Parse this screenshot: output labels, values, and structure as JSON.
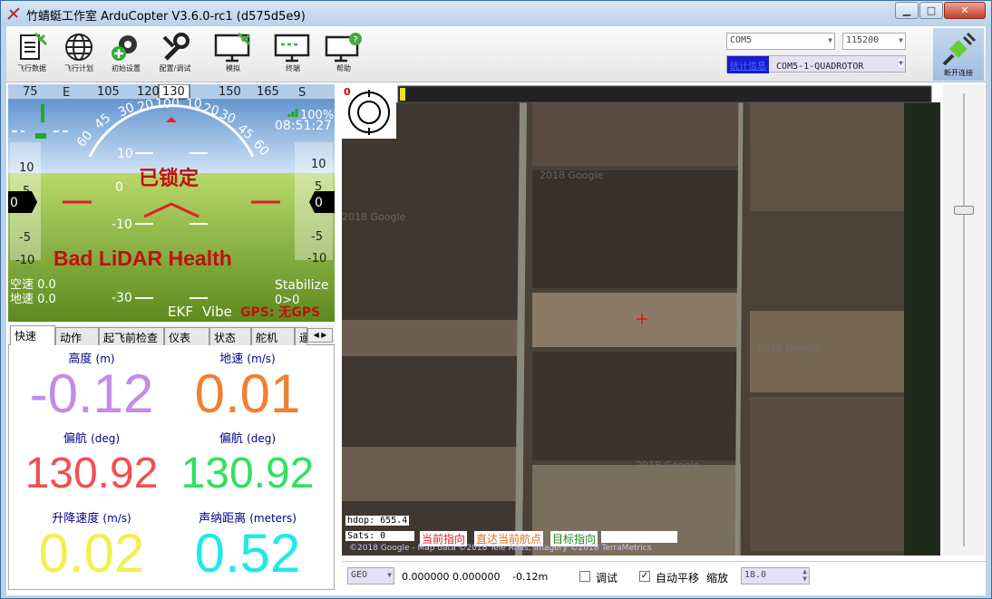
{
  "window": {
    "title": "竹蜻蜓工作室 ArduCopter V3.6.0-rc1 (d575d5e9)",
    "min_label": "▁",
    "max_label": "□",
    "close_label": "✕"
  },
  "toolbar": {
    "items": [
      {
        "label": "飞行数据",
        "icon": "flight-data-icon"
      },
      {
        "label": "飞行计划",
        "icon": "globe-icon"
      },
      {
        "label": "初始设置",
        "icon": "gear-plus-icon"
      },
      {
        "label": "配置/调试",
        "icon": "wrench-icon"
      },
      {
        "label": "模拟",
        "icon": "monitor-plane-icon"
      },
      {
        "label": "终端",
        "icon": "terminal-icon"
      },
      {
        "label": "帮助",
        "icon": "help-icon"
      }
    ],
    "port": "COM5",
    "baud": "115200",
    "link_stats": "统计信息",
    "link_name": "COM5-1-QUADROTOR",
    "connect_label": "断开连接"
  },
  "hud": {
    "heading_ticks": [
      "75",
      "E",
      "105",
      "120",
      "130",
      "150",
      "165",
      "S"
    ],
    "heading_value": "130",
    "roll_ticks": [
      "60",
      "45",
      "30",
      "20",
      "10",
      "0",
      "10",
      "20",
      "30",
      "45",
      "60"
    ],
    "pitch_ticks": [
      "10",
      "0",
      "-10",
      "-30"
    ],
    "speed_ticks": [
      "10",
      "5",
      "0",
      "-5",
      "-10"
    ],
    "alt_ticks": [
      "10",
      "5",
      "0",
      "-5",
      "-10"
    ],
    "speed_box": "0",
    "alt_box": "0",
    "battery": "100%",
    "time": "08:51:27",
    "armed_text": "已锁定",
    "warning": "Bad LiDAR Health",
    "airspeed": "空速 0.0",
    "groundspeed": "地速 0.0",
    "mode": "Stabilize",
    "mode_sub": "0>0",
    "ekf": "EKF",
    "vibe": "Vibe",
    "gps": "GPS: 无GPS"
  },
  "tabs": [
    "快速",
    "动作",
    "起飞前检查",
    "仪表",
    "状态",
    "舵机",
    "遥"
  ],
  "quick": [
    {
      "label": "高度",
      "unit": "(m)",
      "value": "-0.12",
      "color": "#c58be8"
    },
    {
      "label": "地速",
      "unit": "(m/s)",
      "value": "0.01",
      "color": "#f08030"
    },
    {
      "label": "偏航",
      "unit": "(deg)",
      "value": "130.92",
      "color": "#f05050"
    },
    {
      "label": "偏航",
      "unit": "(deg)",
      "value": "130.92",
      "color": "#30e060"
    },
    {
      "label": "升降速度",
      "unit": "(m/s)",
      "value": "0.02",
      "color": "#f0f050"
    },
    {
      "label": "声纳距离",
      "unit": "(meters)",
      "value": "0.52",
      "color": "#20e8e8"
    }
  ],
  "map": {
    "compass_value": "0",
    "watermarks": [
      "2018 Google",
      "2018 Google",
      "2018 Google",
      "2018 Google"
    ],
    "hdop": "hdop: 655.4",
    "sats": "Sats: 0",
    "btn_current": "当前指向",
    "btn_direct": "直达当前航点",
    "btn_target": "目标指向",
    "copyright": "©2018 Google - Map data ©2018 Tele Atlas, Imagery ©2018 TerraMetrics"
  },
  "mapbar": {
    "coord_type": "GEO",
    "lat": "0.000000",
    "lng": "0.000000",
    "alt": "-0.12m",
    "debug_label": "调试",
    "autopan_label": "自动平移",
    "zoom_label": "缩放",
    "zoom_value": "18.0"
  }
}
